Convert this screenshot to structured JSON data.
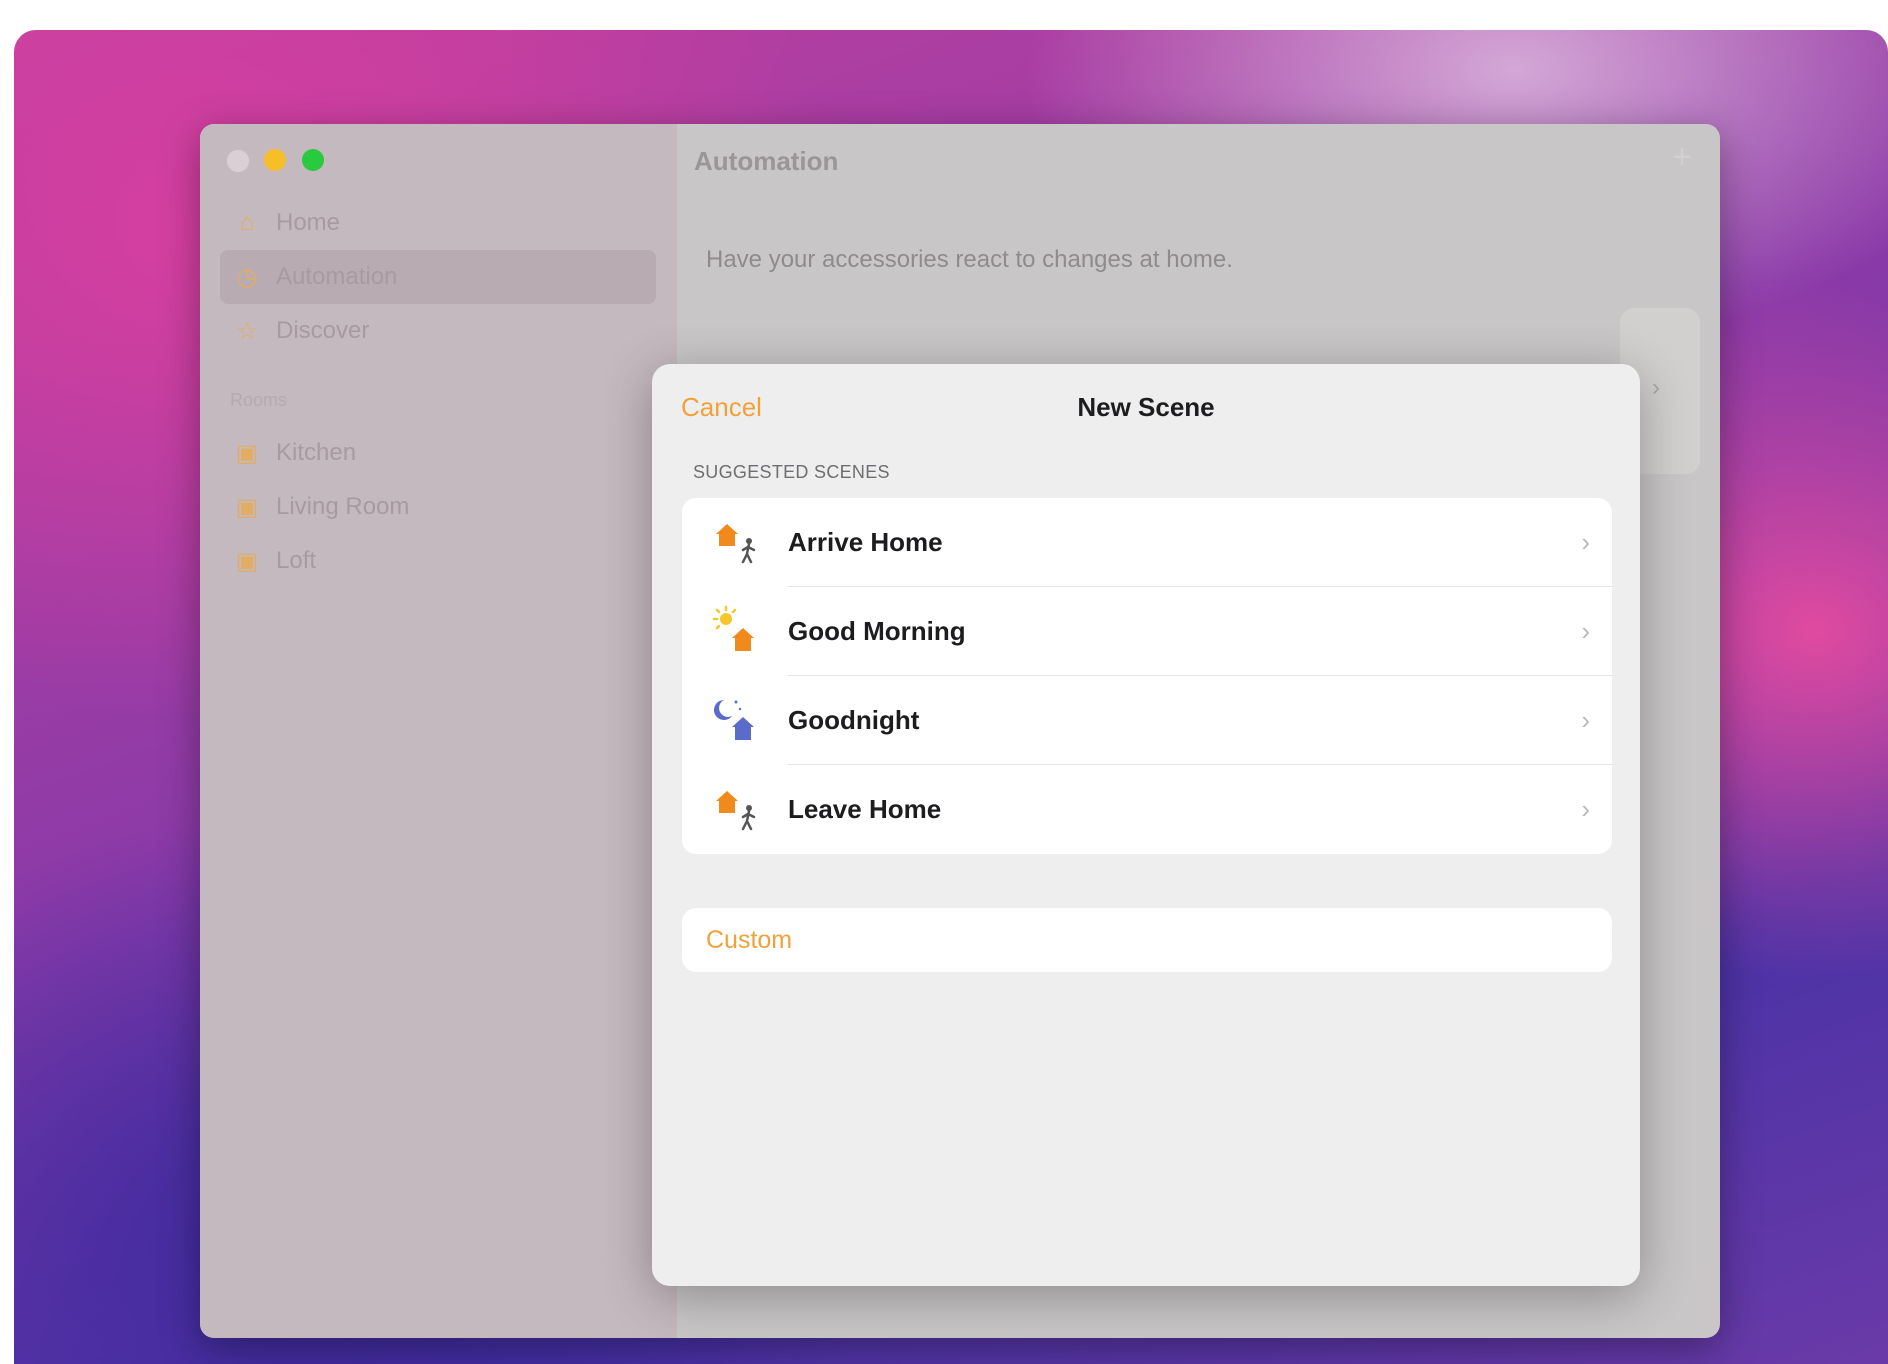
{
  "window": {
    "title": "Automation",
    "add_icon": "+",
    "subtitle": "Have your accessories react to changes at home."
  },
  "sidebar": {
    "items": [
      {
        "label": "Home",
        "icon": "house-icon",
        "glyph": "⌂"
      },
      {
        "label": "Automation",
        "icon": "clock-icon",
        "glyph": "◷"
      },
      {
        "label": "Discover",
        "icon": "star-icon",
        "glyph": "☆"
      }
    ],
    "rooms_header": "Rooms",
    "rooms": [
      {
        "label": "Kitchen",
        "icon": "room-icon",
        "glyph": "▣"
      },
      {
        "label": "Living Room",
        "icon": "room-icon",
        "glyph": "▣"
      },
      {
        "label": "Loft",
        "icon": "room-icon",
        "glyph": "▣"
      }
    ]
  },
  "modal": {
    "cancel_label": "Cancel",
    "title": "New Scene",
    "section_header": "SUGGESTED SCENES",
    "scenes": [
      {
        "label": "Arrive Home",
        "icon": "arrive-home-icon"
      },
      {
        "label": "Good Morning",
        "icon": "good-morning-icon"
      },
      {
        "label": "Goodnight",
        "icon": "goodnight-icon"
      },
      {
        "label": "Leave Home",
        "icon": "leave-home-icon"
      }
    ],
    "chevron": "›",
    "custom_label": "Custom"
  },
  "colors": {
    "accent": "#f0a23a",
    "house_orange": "#f08a1c",
    "night_blue": "#5b6bc9"
  }
}
